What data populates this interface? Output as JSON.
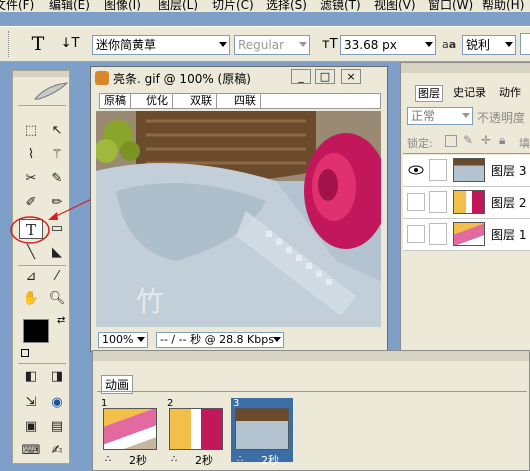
{
  "menubar": {
    "items": [
      "文件(F)",
      "编辑(E)",
      "图像(I)",
      "图层(L)",
      "切片(C)",
      "选择(S)",
      "滤镜(T)",
      "视图(V)",
      "窗口(W)",
      "帮助(H)"
    ]
  },
  "options": {
    "font_family": "迷你简黄草",
    "font_style": "Regular",
    "font_size": "33.68 px",
    "aa_label": "a",
    "aa_mode": "锐利"
  },
  "document": {
    "title": "亮条. gif @ 100% (原稿)",
    "tabs": [
      "原稿",
      "优化",
      "双联",
      "四联"
    ],
    "zoom": "100%",
    "status": "-- / -- 秒 @ 28.8 Kbps",
    "watermark": "竹"
  },
  "layers_panel": {
    "tabs": [
      "图层",
      "史记录",
      "动作"
    ],
    "blend_mode": "正常",
    "opacity_label": "不透明度",
    "lock_label": "锁定:",
    "fill_label": "填",
    "layers": [
      {
        "name": "图层 3",
        "visible": true
      },
      {
        "name": "图层 2",
        "visible": false
      },
      {
        "name": "图层 1",
        "visible": false
      }
    ]
  },
  "animation_panel": {
    "tab": "动画",
    "frames": [
      {
        "number": "1",
        "delay": "2秒"
      },
      {
        "number": "2",
        "delay": "2秒"
      },
      {
        "number": "3",
        "delay": "2秒"
      }
    ]
  },
  "colors": {
    "desktop": "#7d9fc8",
    "chrome": "#ece9d8",
    "selection": "#3a6ea5",
    "annotation": "#d22020",
    "foreground": "#000000",
    "background": "#ffffff"
  }
}
